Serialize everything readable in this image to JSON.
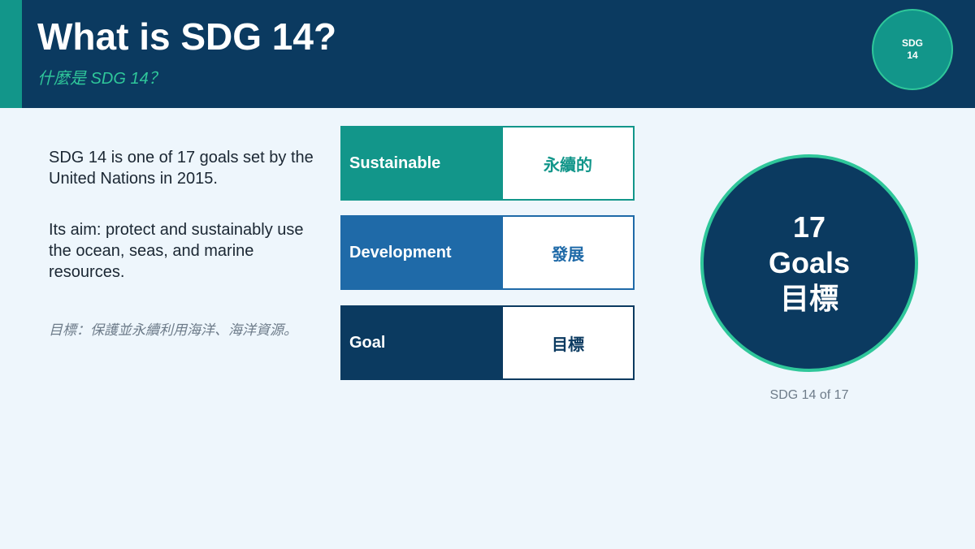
{
  "header": {
    "title": "What is SDG 14?",
    "subtitle": "什麼是 SDG 14？",
    "badge_line1": "SDG",
    "badge_line2": "14"
  },
  "content": {
    "paragraph1": "SDG 14 is one of 17 goals set by the United Nations in 2015.",
    "paragraph2": "Its aim: protect and sustainably use the ocean, seas, and marine resources.",
    "note": "目標：保護並永續利用海洋、海洋資源。"
  },
  "terms": [
    {
      "term": "Sustainable",
      "translation": "永續的"
    },
    {
      "term": "Development",
      "translation": "發展"
    },
    {
      "term": "Goal",
      "translation": "目標"
    }
  ],
  "goals_circle": {
    "line1": "17",
    "line2": "Goals",
    "line3": "目標",
    "caption": "SDG 14 of 17"
  },
  "colors": {
    "navy": "#0b3a60",
    "teal": "#12968a",
    "blue": "#1f6aa8",
    "green_accent": "#2fc79a",
    "background": "#eef6fc"
  }
}
